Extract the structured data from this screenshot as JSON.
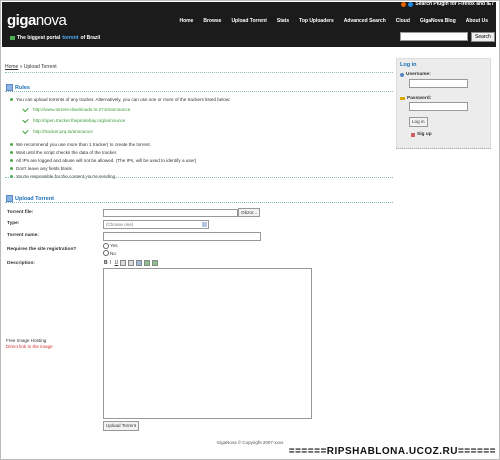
{
  "header": {
    "logo_bold": "giga",
    "logo_rest": "nova",
    "tagline_prefix": "The biggest portal ",
    "tagline_highlight": "torrent",
    "tagline_suffix": " of Brazil",
    "plugin_text": "Search Plugin for Firefox and IE7",
    "nav": [
      "Home",
      "Browse",
      "Upload Torrent",
      "Stats",
      "Top Uploaders",
      "Advanced Search",
      "Cloud",
      "GigaNova Blog",
      "About Us"
    ],
    "search_button": "Search"
  },
  "breadcrumb": {
    "home": "Home",
    "separator": " » ",
    "current": "Upload Torrent"
  },
  "rules": {
    "title": "Rules",
    "intro": "You can upload torrents of any tracker. Alternatively, you can use one or more of the trackers listed below:",
    "trackers": [
      "http://www.torrent-downloads.to:2710/announce",
      "http://open.tracker.thepiratebay.org/announce",
      "http://tracker.prq.to/announce"
    ],
    "items": [
      "We recommend you use more than 1 tracker) to create the torrent.",
      "Wait until the script checks the data of the tracker.",
      "All IPs are logged and abuse will not be allowed. (The IPs, will be used to identify a user)",
      "Don't leave any fields blank.",
      "You're responsible for the content you're sending."
    ]
  },
  "upload": {
    "title": "Upload Torrent",
    "torrent_file_label": "Torrent file:",
    "browse_button": "Obzor...",
    "type_label": "Type:",
    "type_selected": "(Choose one)",
    "name_label": "Torrent name:",
    "registration_label": "Requires the site registration?",
    "yes": "Yes",
    "no": "No",
    "description_label": "Description:",
    "toolbar": [
      "B",
      "I",
      "U"
    ],
    "image_hosting": "Free Image Hosting",
    "direct_link": "Direct link to the image",
    "submit": "Upload Torrent"
  },
  "sidebar": {
    "title": "Log in",
    "username_label": "Username:",
    "password_label": "Password:",
    "login_button": "Log in",
    "signup": "Sig up"
  },
  "footer": {
    "copyright": "GigaNova © Copyright 2007-xxxx",
    "watermark": "======RIPSHABLONA.UCOZ.RU======"
  }
}
